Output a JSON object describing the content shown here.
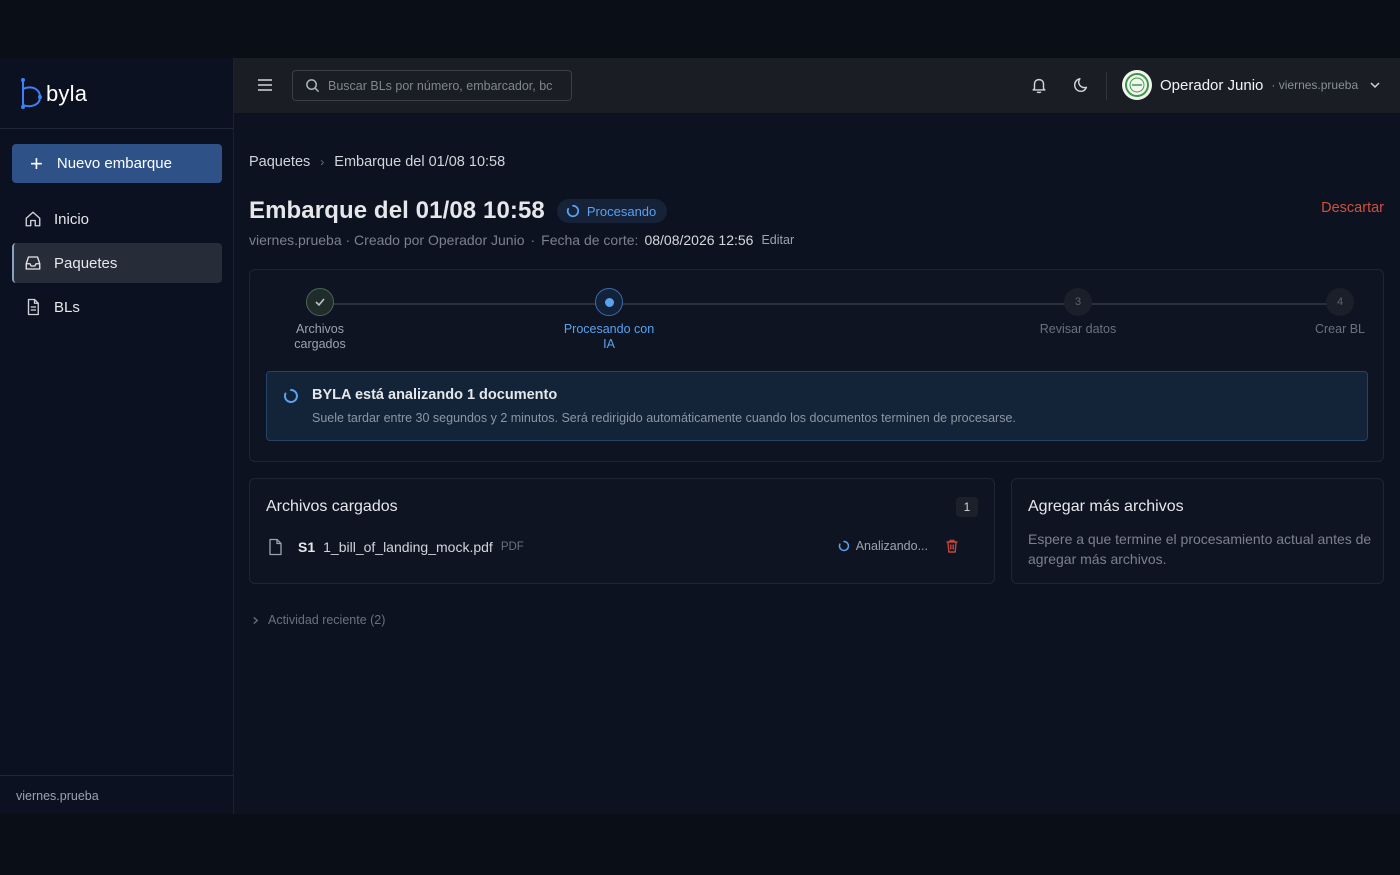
{
  "brand": {
    "name": "byla",
    "accent": "#2e5288"
  },
  "sidebar": {
    "new_button": "Nuevo embarque",
    "items": [
      {
        "label": "Inicio",
        "icon": "home-icon",
        "active": false
      },
      {
        "label": "Paquetes",
        "icon": "inbox-icon",
        "active": true
      },
      {
        "label": "BLs",
        "icon": "document-icon",
        "active": false
      }
    ],
    "footer": "viernes.prueba"
  },
  "topbar": {
    "search_placeholder": "Buscar BLs por número, embarcador, bc",
    "user": {
      "name": "Operador Junio",
      "org": "· viernes.prueba"
    }
  },
  "page": {
    "breadcrumb": [
      "Paquetes",
      "Embarque del 01/08 10:58"
    ],
    "title": "Embarque del 01/08 10:58",
    "status": "Procesando",
    "discard": "Descartar",
    "meta": {
      "org_creator": "viernes.prueba · Creado por Operador Junio",
      "cut_label": "Fecha de corte:",
      "cut_date": "08/08/2026 12:56",
      "edit": "Editar"
    },
    "steps": [
      {
        "label_line1": "Archivos",
        "label_line2": "cargados",
        "state": "done",
        "num": "1"
      },
      {
        "label_line1": "Procesando con",
        "label_line2": "IA",
        "state": "active",
        "num": "2"
      },
      {
        "label_line1": "Revisar datos",
        "label_line2": "",
        "state": "pending",
        "num": "3"
      },
      {
        "label_line1": "Crear BL",
        "label_line2": "",
        "state": "pending",
        "num": "4"
      }
    ],
    "notice": {
      "title": "BYLA está analizando 1 documento",
      "body": "Suele tardar entre 30 segundos y 2 minutos. Será redirigido automáticamente cuando los documentos terminen de procesarse."
    },
    "files": {
      "title": "Archivos cargados",
      "count": "1",
      "items": [
        {
          "seq": "S1",
          "name": "1_bill_of_landing_mock.pdf",
          "type": "PDF",
          "status": "Analizando..."
        }
      ]
    },
    "add_files": {
      "title": "Agregar más archivos",
      "body": "Espere a que termine el procesamiento actual antes de agregar más archivos."
    },
    "activity": "Actividad reciente (2)"
  }
}
